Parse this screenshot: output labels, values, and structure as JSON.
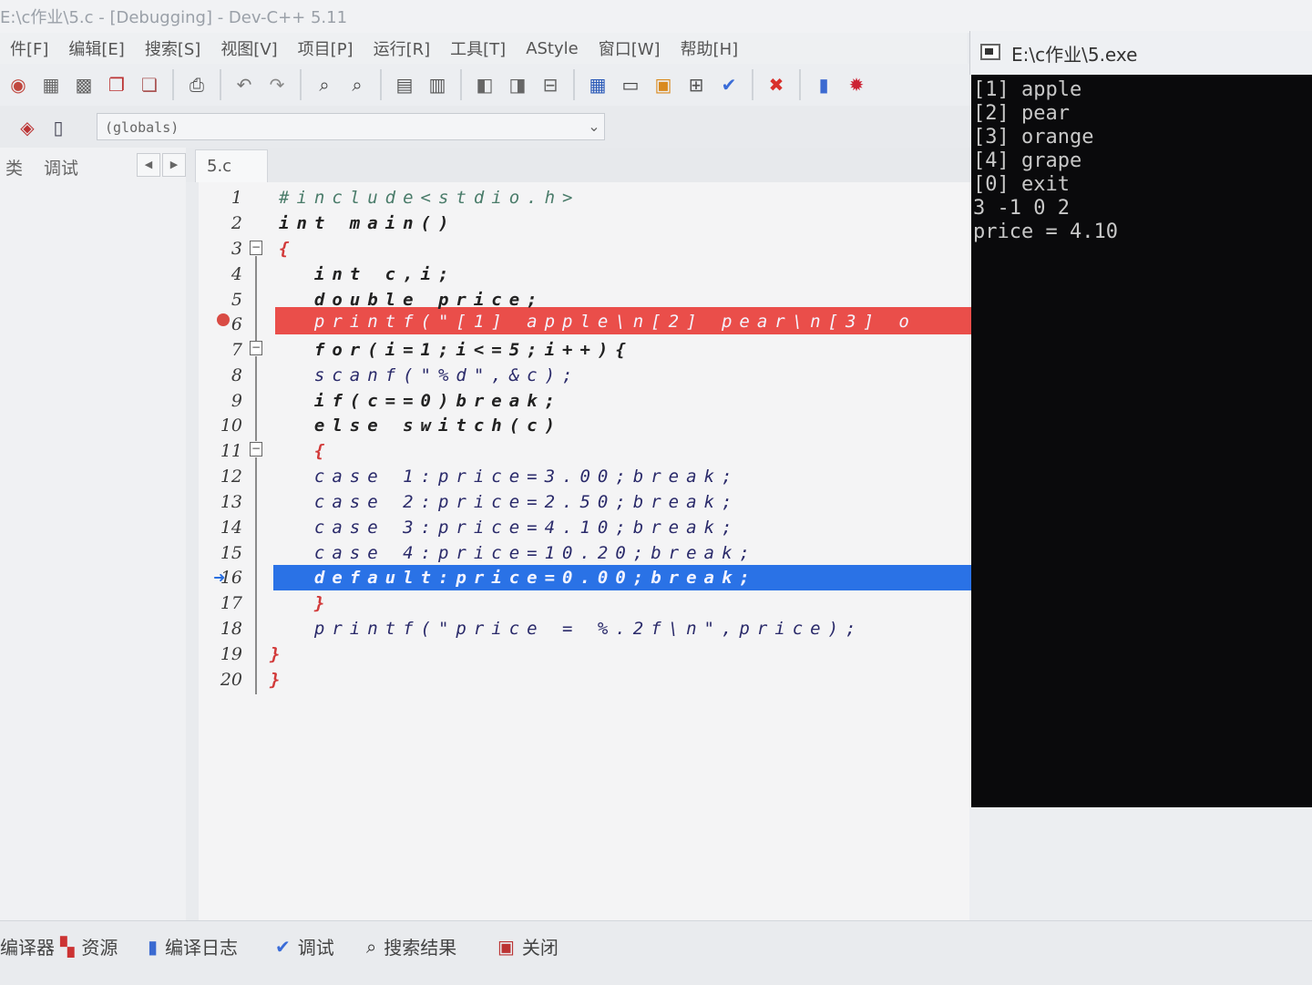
{
  "window": {
    "title": "E:\\c作业\\5.c - [Debugging] - Dev-C++ 5.11"
  },
  "menu": [
    "件[F]",
    "编辑[E]",
    "搜索[S]",
    "视图[V]",
    "项目[P]",
    "运行[R]",
    "工具[T]",
    "AStyle",
    "窗口[W]",
    "帮助[H]"
  ],
  "toolbar": {
    "icons": [
      "stop-icon",
      "grid-icon",
      "grid-icon",
      "copy-icon",
      "copy-icon",
      "print-icon",
      "undo-icon",
      "redo-icon",
      "search-icon",
      "replace-icon",
      "layout-icon",
      "layout-icon",
      "page-icon",
      "page-icon",
      "minus-icon",
      "grid-icon",
      "window-icon",
      "color-grid-icon",
      "tiles-icon",
      "check-icon",
      "close-icon",
      "chart-icon",
      "debug-icon"
    ],
    "colors": {
      "check": "#3a6cd8",
      "close": "#d9302b",
      "chart": "#3b6ad1"
    }
  },
  "globals_combo": {
    "value": "(globals)"
  },
  "left_panel": {
    "tabs": [
      "类",
      "调试"
    ]
  },
  "editor": {
    "file_tab": "5.c",
    "line_numbers": [
      "1",
      "2",
      "3",
      "4",
      "5",
      "6",
      "7",
      "8",
      "9",
      "10",
      "11",
      "12",
      "13",
      "14",
      "15",
      "16",
      "17",
      "18",
      "19",
      "20"
    ],
    "lines": [
      "#include<stdio.h>",
      "int main()",
      "{",
      "  int c,i;",
      "  double price;",
      "  printf(\"[1] apple\\n[2] pear\\n[3] o",
      "  for(i=1;i<=5;i++){",
      "  scanf(\"%d\",&c);",
      "  if(c==0)break;",
      "  else switch(c)",
      "  {",
      "  case 1:price=3.00;break;",
      "  case 2:price=2.50;break;",
      "  case 3:price=4.10;break;",
      "  case 4:price=10.20;break;",
      "  default:price=0.00;break;",
      "  }",
      "  printf(\"price = %.2f\\n\",price);",
      "}",
      "}"
    ],
    "breakpoint_line": "6",
    "current_line": "16",
    "colors": {
      "breakpoint": "#ea4e4a",
      "current": "#2a72e6"
    }
  },
  "console": {
    "title": "E:\\c作业\\5.exe",
    "lines": [
      "[1] apple",
      "[2] pear",
      "[3] orange",
      "[4] grape",
      "[0] exit",
      "3 -1 0 2",
      "price = 4.10"
    ]
  },
  "bottom_tabs": [
    "编译器",
    "资源",
    "编译日志",
    "调试",
    "搜索结果",
    "关闭"
  ]
}
